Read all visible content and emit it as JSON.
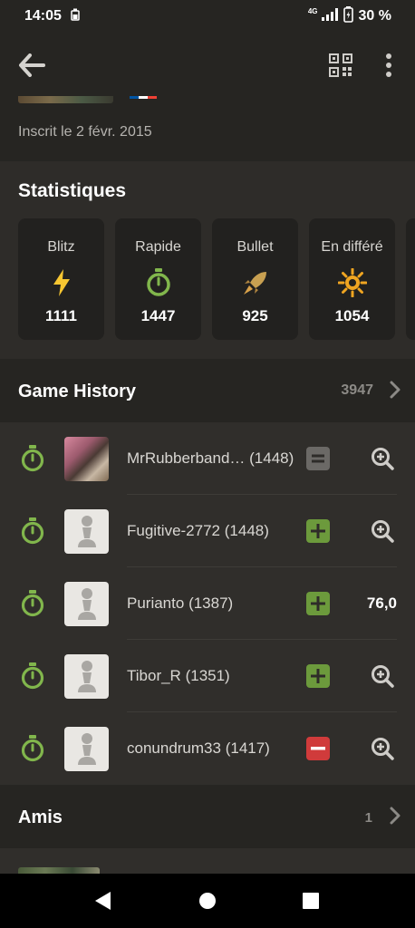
{
  "status_bar": {
    "time": "14:05",
    "network": "4G",
    "battery": "30 %"
  },
  "app_bar": {
    "icons": [
      "back-arrow-icon",
      "qr-code-icon",
      "more-vert-icon"
    ]
  },
  "profile": {
    "joined": "Inscrit le 2 févr. 2015",
    "flag_colors": [
      "#0055a4",
      "#ffffff",
      "#ef4135"
    ]
  },
  "stats": {
    "title": "Statistiques",
    "cards": [
      {
        "label": "Blitz",
        "value": "1111",
        "icon": "lightning-icon",
        "color": "#f7c631"
      },
      {
        "label": "Rapide",
        "value": "1447",
        "icon": "stopwatch-icon",
        "color": "#81b64c"
      },
      {
        "label": "Bullet",
        "value": "925",
        "icon": "bullet-rocket-icon",
        "color": "#c8a051"
      },
      {
        "label": "En différé",
        "value": "1054",
        "icon": "sun-icon",
        "color": "#f0a521"
      }
    ]
  },
  "game_history": {
    "title": "Game History",
    "count": "3947",
    "games": [
      {
        "player": "MrRubberband…",
        "rating": "(1448)",
        "result": "draw",
        "avatar": "photo",
        "trailing": "analysis"
      },
      {
        "player": "Fugitive-2772",
        "rating": "(1448)",
        "result": "win",
        "avatar": "pawn",
        "trailing": "analysis"
      },
      {
        "player": "Purianto",
        "rating": "(1387)",
        "result": "win",
        "avatar": "pawn",
        "trailing": "accuracy",
        "accuracy": "76,0"
      },
      {
        "player": "Tibor_R",
        "rating": "(1351)",
        "result": "win",
        "avatar": "pawn",
        "trailing": "analysis"
      },
      {
        "player": "conundrum33",
        "rating": "(1417)",
        "result": "loss",
        "avatar": "pawn",
        "trailing": "analysis"
      }
    ]
  },
  "friends": {
    "title": "Amis",
    "count": "1"
  },
  "colors": {
    "accent_green": "#81b64c",
    "win": "#6c9a3c",
    "loss": "#d03b3b",
    "draw": "#6b6966"
  }
}
